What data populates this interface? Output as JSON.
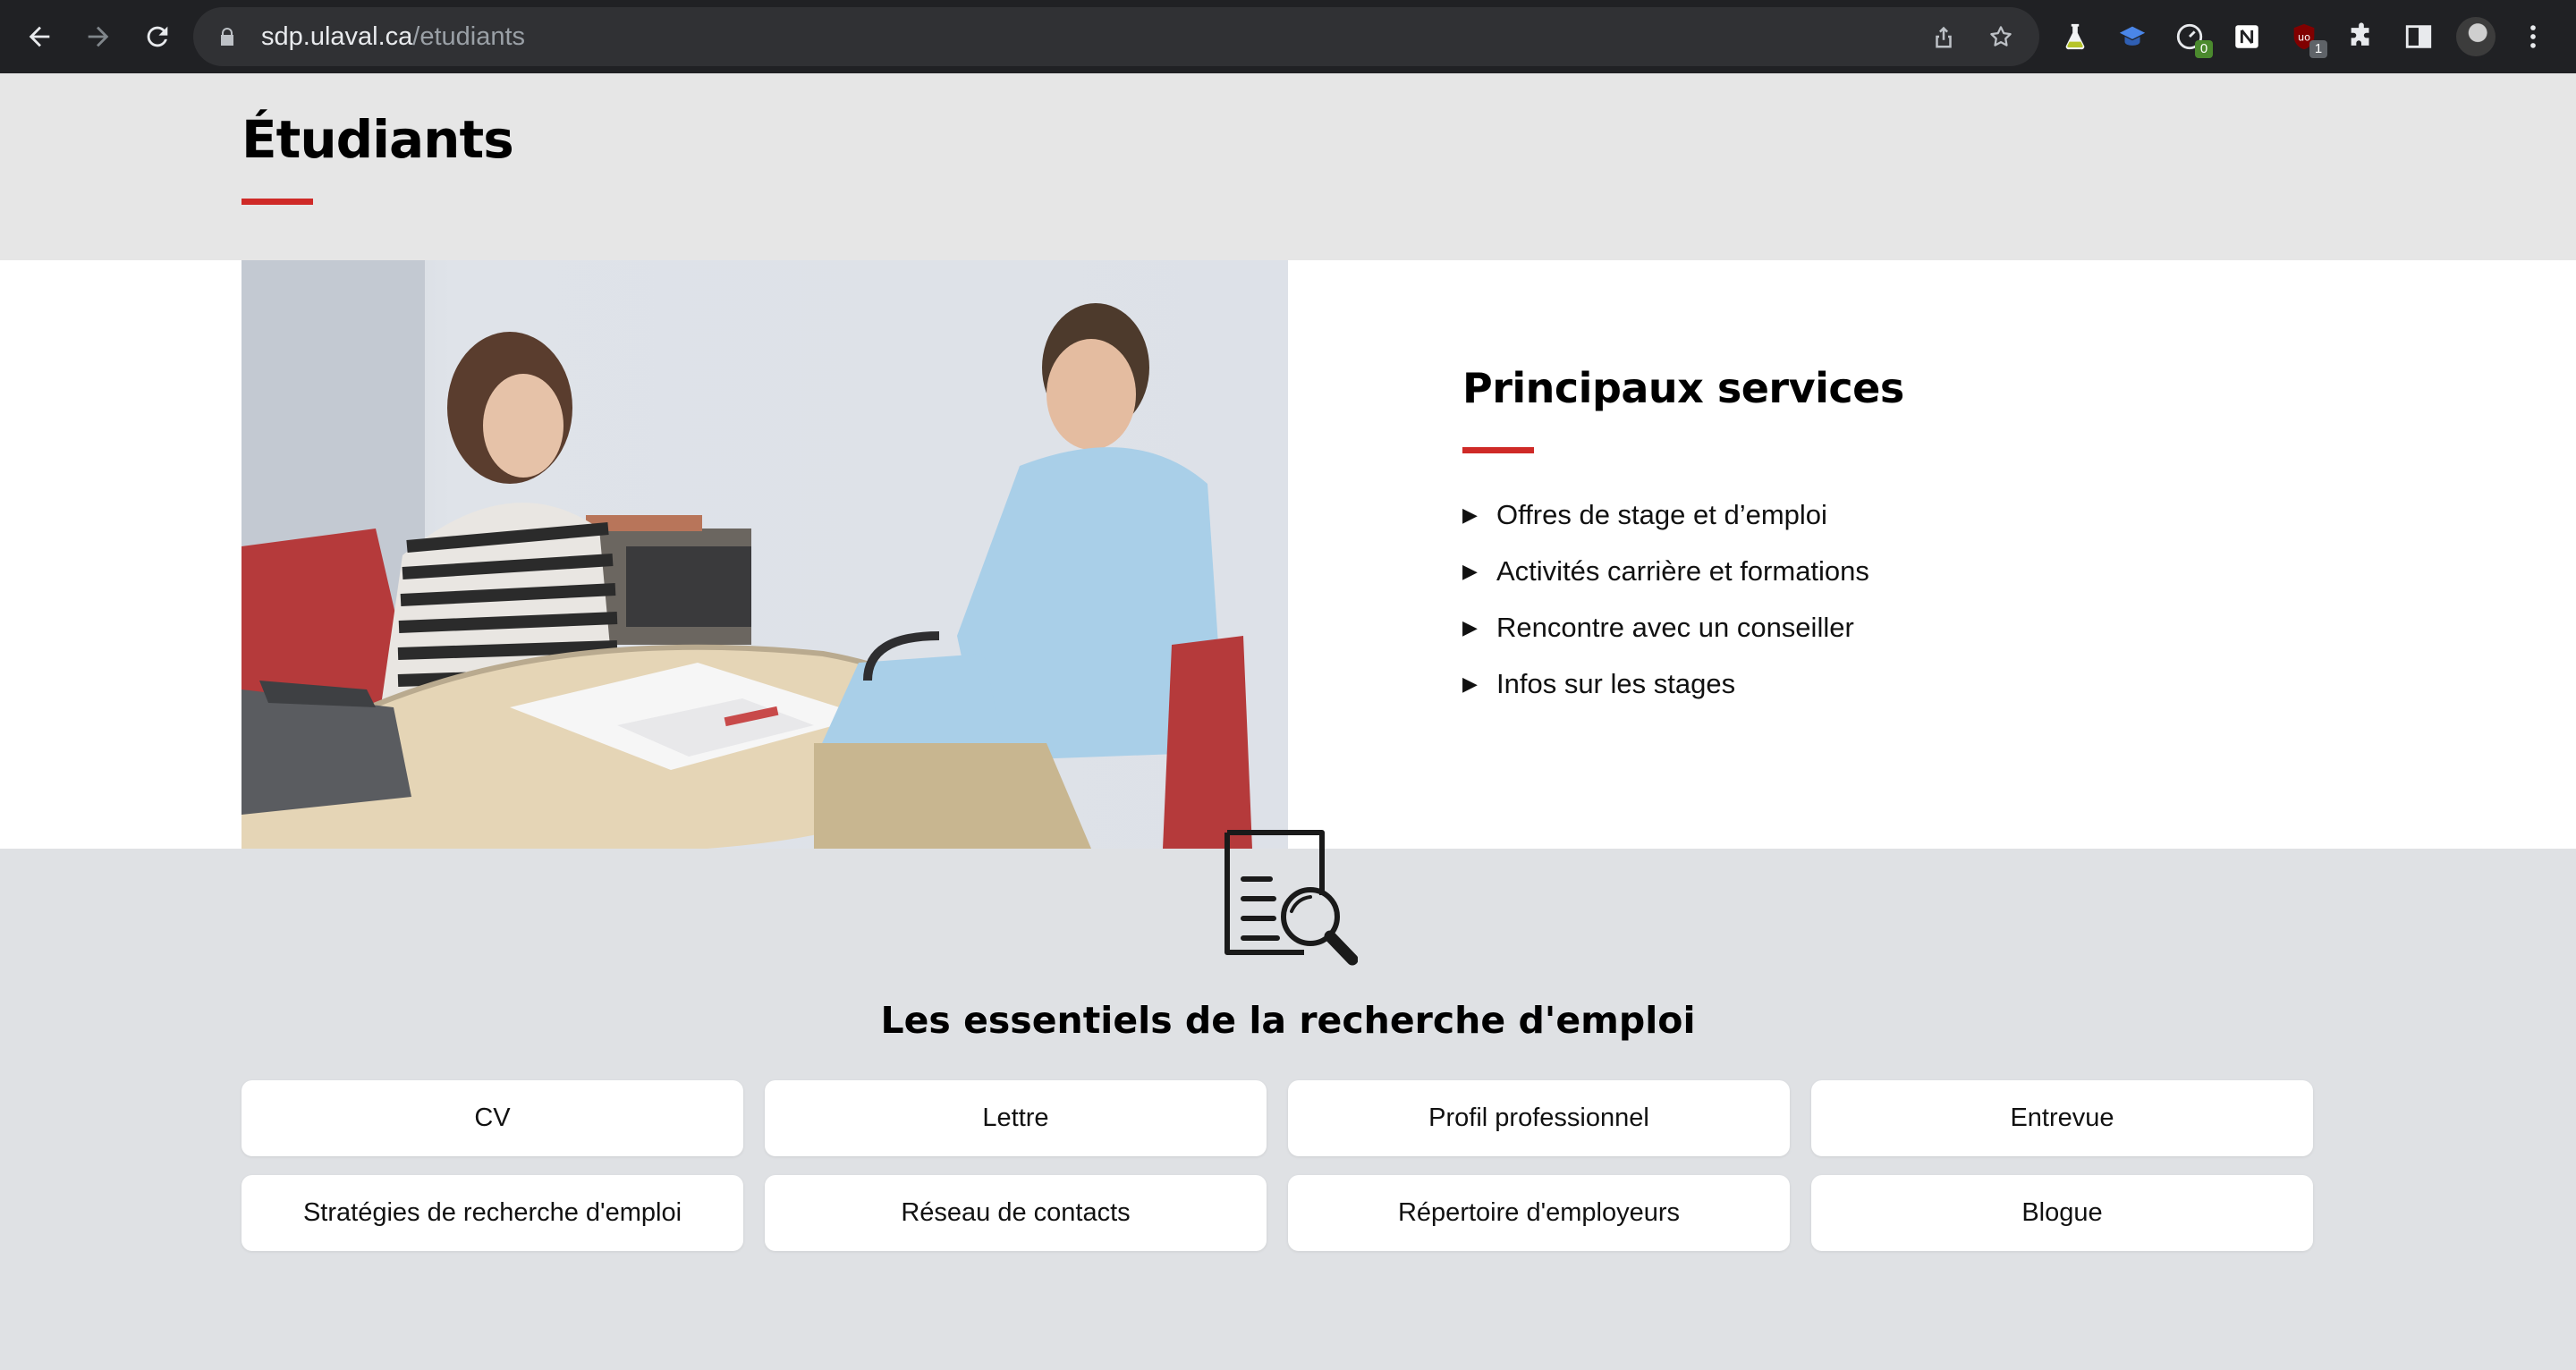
{
  "browser": {
    "url_host": "sdp.ulaval.ca",
    "url_path": "/etudiants",
    "extension_badges": [
      "0",
      "1"
    ],
    "icons": [
      "back-icon",
      "forward-icon",
      "reload-icon",
      "lock-icon",
      "share-icon",
      "star-icon",
      "flask-extension-icon",
      "graduation-extension-icon",
      "speed-extension-icon",
      "notion-extension-icon",
      "ublock-extension-icon",
      "puzzle-icon",
      "side-panel-icon",
      "avatar",
      "kebab-menu-icon"
    ]
  },
  "page": {
    "title": "Étudiants",
    "accent_color": "#cf2a27",
    "services": {
      "title": "Principaux services",
      "items": [
        "Offres de stage et d’emploi",
        "Activités carrière et formations",
        "Rencontre avec un conseiller",
        "Infos sur les stages"
      ]
    },
    "essentials": {
      "icon": "document-search-icon",
      "title": "Les essentiels de la recherche d'emploi",
      "cards": [
        "CV",
        "Lettre",
        "Profil professionnel",
        "Entrevue",
        "Stratégies de recherche d'emploi",
        "Réseau de contacts",
        "Répertoire d'employeurs",
        "Blogue"
      ]
    }
  }
}
